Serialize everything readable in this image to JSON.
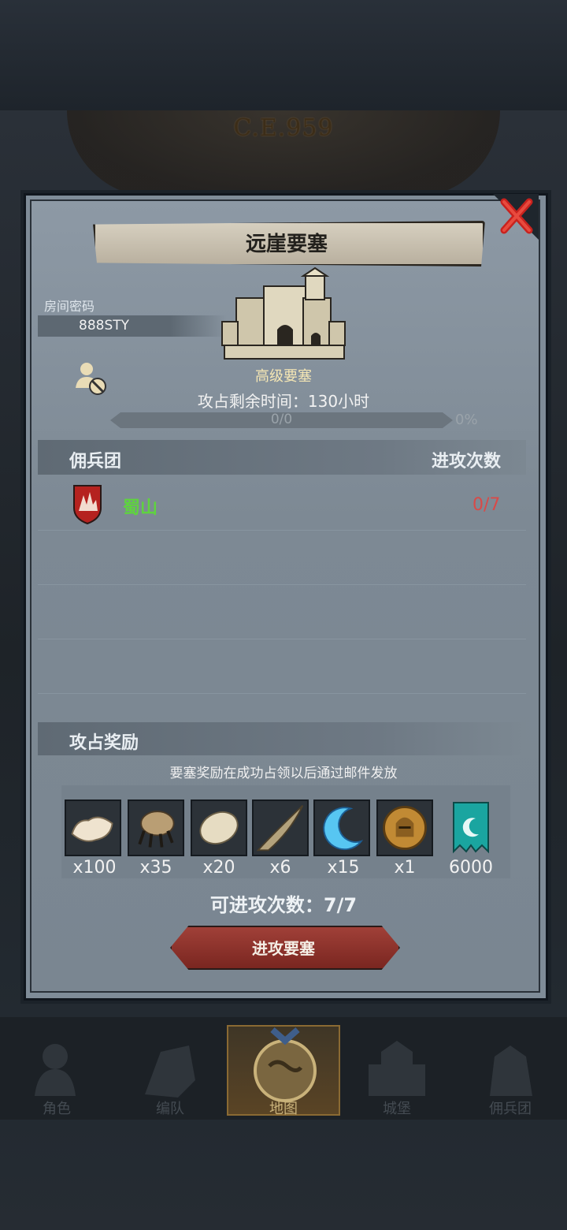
{
  "background": {
    "era_label": "C.E.959"
  },
  "modal": {
    "title": "远崖要塞",
    "room_code_label": "房间密码",
    "room_code_value": "888STY",
    "fortress_type": "高级要塞",
    "remaining_time": "攻占剩余时间：130小时",
    "progress": {
      "text": "0/0",
      "percent_label": "0%",
      "fraction": 0
    },
    "list_header": {
      "left": "佣兵团",
      "right": "进攻次数"
    },
    "guilds": [
      {
        "name": "蜀山",
        "attack_count": "0/7",
        "name_color": "#5fd33f",
        "count_color": "#d94a48"
      }
    ],
    "rewards": {
      "title": "攻占奖励",
      "note": "要塞奖励在成功占领以后通过邮件发放",
      "items": [
        {
          "icon": "fur-pelt-icon",
          "qty": "x100"
        },
        {
          "icon": "beast-claw-icon",
          "qty": "x35"
        },
        {
          "icon": "feather-hide-icon",
          "qty": "x20"
        },
        {
          "icon": "twisted-horn-icon",
          "qty": "x6"
        },
        {
          "icon": "crescent-moon-icon",
          "qty": "x15"
        },
        {
          "icon": "knight-helmet-medal-icon",
          "qty": "x1"
        },
        {
          "icon": "guild-banner-icon",
          "qty": "6000"
        }
      ]
    },
    "attacks_available": "可进攻次数：7/7",
    "attack_button": "进攻要塞"
  },
  "bottom_nav": {
    "items": [
      {
        "label": "角色",
        "icon": "character-icon"
      },
      {
        "label": "编队",
        "icon": "formation-icon"
      },
      {
        "label": "地图",
        "icon": "map-icon",
        "active": true
      },
      {
        "label": "城堡",
        "icon": "castle-icon"
      },
      {
        "label": "佣兵团",
        "icon": "mercenary-icon"
      }
    ]
  },
  "colors": {
    "accent_red": "#a04038",
    "guild_green": "#5fd33f",
    "count_red": "#d94a48",
    "active_tab": "#8a6a33"
  }
}
